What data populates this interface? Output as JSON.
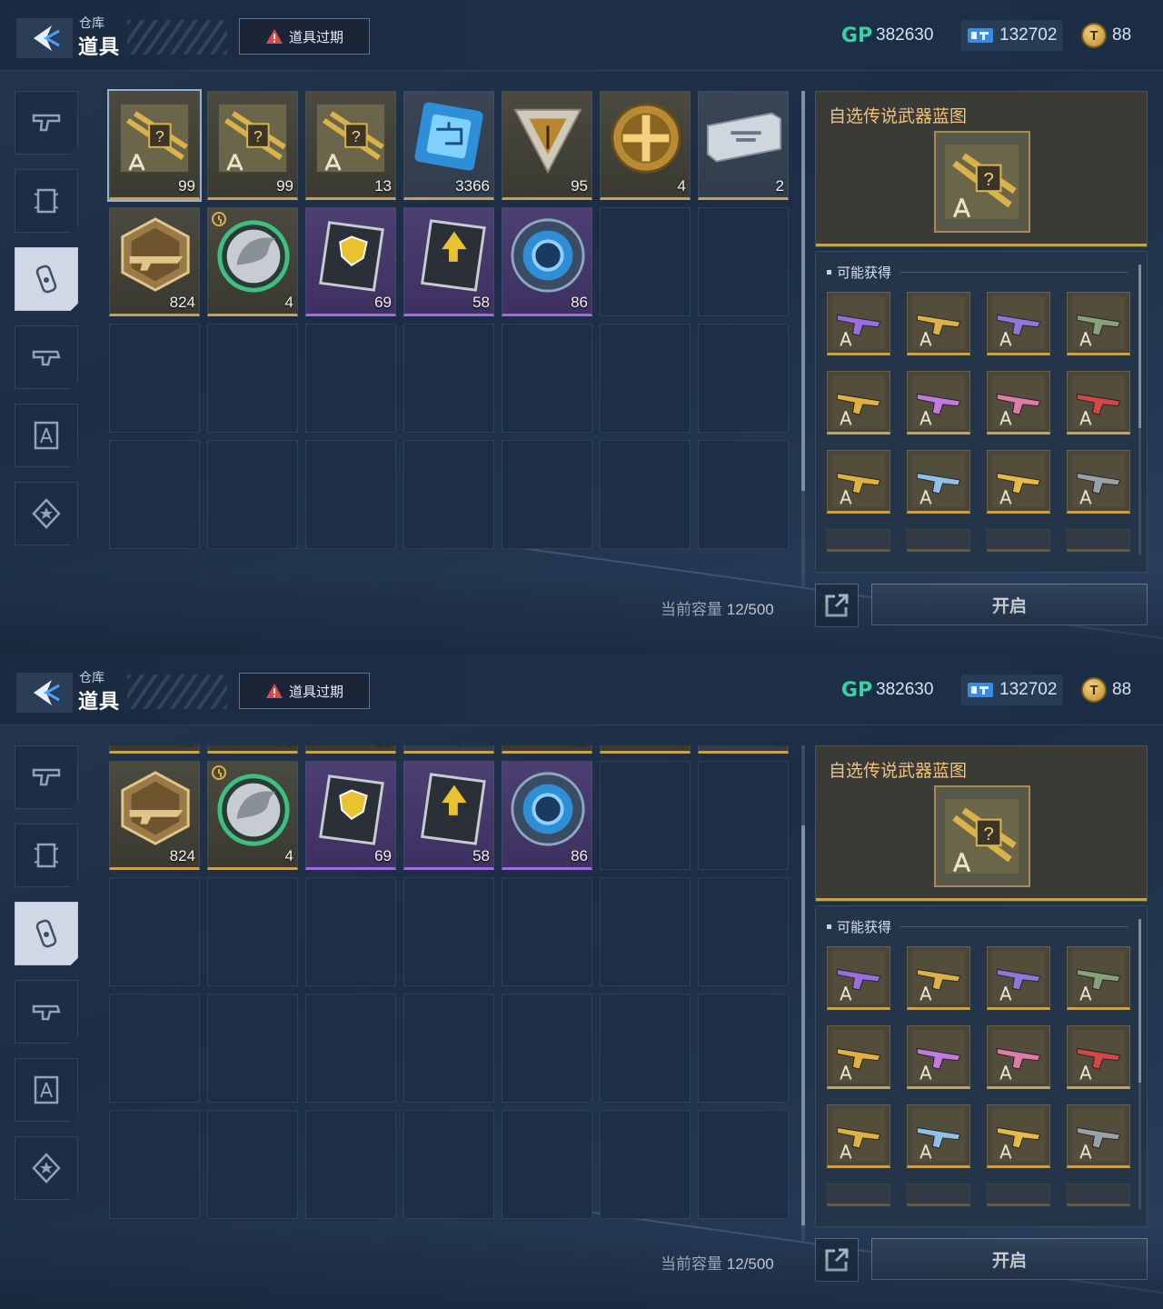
{
  "header": {
    "breadcrumb_parent": "仓库",
    "title": "道具",
    "expire_button": "道具过期"
  },
  "currency": {
    "gp_label": "GP",
    "gp": "382630",
    "tickets": "132702",
    "coins": "88",
    "coin_glyph": "T"
  },
  "side_tabs": [
    "pistol-icon",
    "frame-icon",
    "capsule-icon",
    "weapon-part-icon",
    "blueprint-icon",
    "star-badge-icon"
  ],
  "active_tab_index": 2,
  "items": [
    {
      "icon": "legendary-blueprint-icon",
      "count": "99",
      "rarity": "gold"
    },
    {
      "icon": "legendary-blueprint-icon",
      "count": "99",
      "rarity": "gold"
    },
    {
      "icon": "legendary-blueprint-icon",
      "count": "13",
      "rarity": "gold"
    },
    {
      "icon": "circuit-chip-icon",
      "count": "3366",
      "rarity": "gold"
    },
    {
      "icon": "triangle-emblem-icon",
      "count": "95",
      "rarity": "gold"
    },
    {
      "icon": "gold-cross-coin-icon",
      "count": "4",
      "rarity": "gold"
    },
    {
      "icon": "silver-card-icon",
      "count": "2",
      "rarity": "gold"
    },
    {
      "icon": "rifle-hex-badge-icon",
      "count": "824",
      "rarity": "gold"
    },
    {
      "icon": "winged-helmet-token-icon",
      "count": "4",
      "rarity": "gold",
      "timed": true
    },
    {
      "icon": "shield-card-pack-icon",
      "count": "69",
      "rarity": "purple"
    },
    {
      "icon": "arrow-card-pack-icon",
      "count": "58",
      "rarity": "purple"
    },
    {
      "icon": "blue-ring-core-icon",
      "count": "86",
      "rarity": "purple"
    }
  ],
  "capacity": {
    "label": "当前容量",
    "value": "12/500"
  },
  "detail": {
    "title": "自选传说武器蓝图",
    "rewards_heading": "可能获得",
    "rewards": [
      "purple-smg-icon",
      "black-gold-rifle-icon",
      "purple-sniper-icon",
      "camo-rifle-icon",
      "gold-sniper-icon",
      "purple-rifle-icon",
      "pink-rifle-icon",
      "red-shotgun-icon",
      "gold-pistol-icon",
      "blue-white-rifle-icon",
      "gold-rifle-icon",
      "dark-rifle-icon"
    ]
  },
  "actions": {
    "open_button": "开启"
  },
  "colors": {
    "gold": "#c9a24b",
    "purple": "#a06ce0",
    "gp_green": "#35d3a2",
    "title_gold": "#f0c27a"
  }
}
